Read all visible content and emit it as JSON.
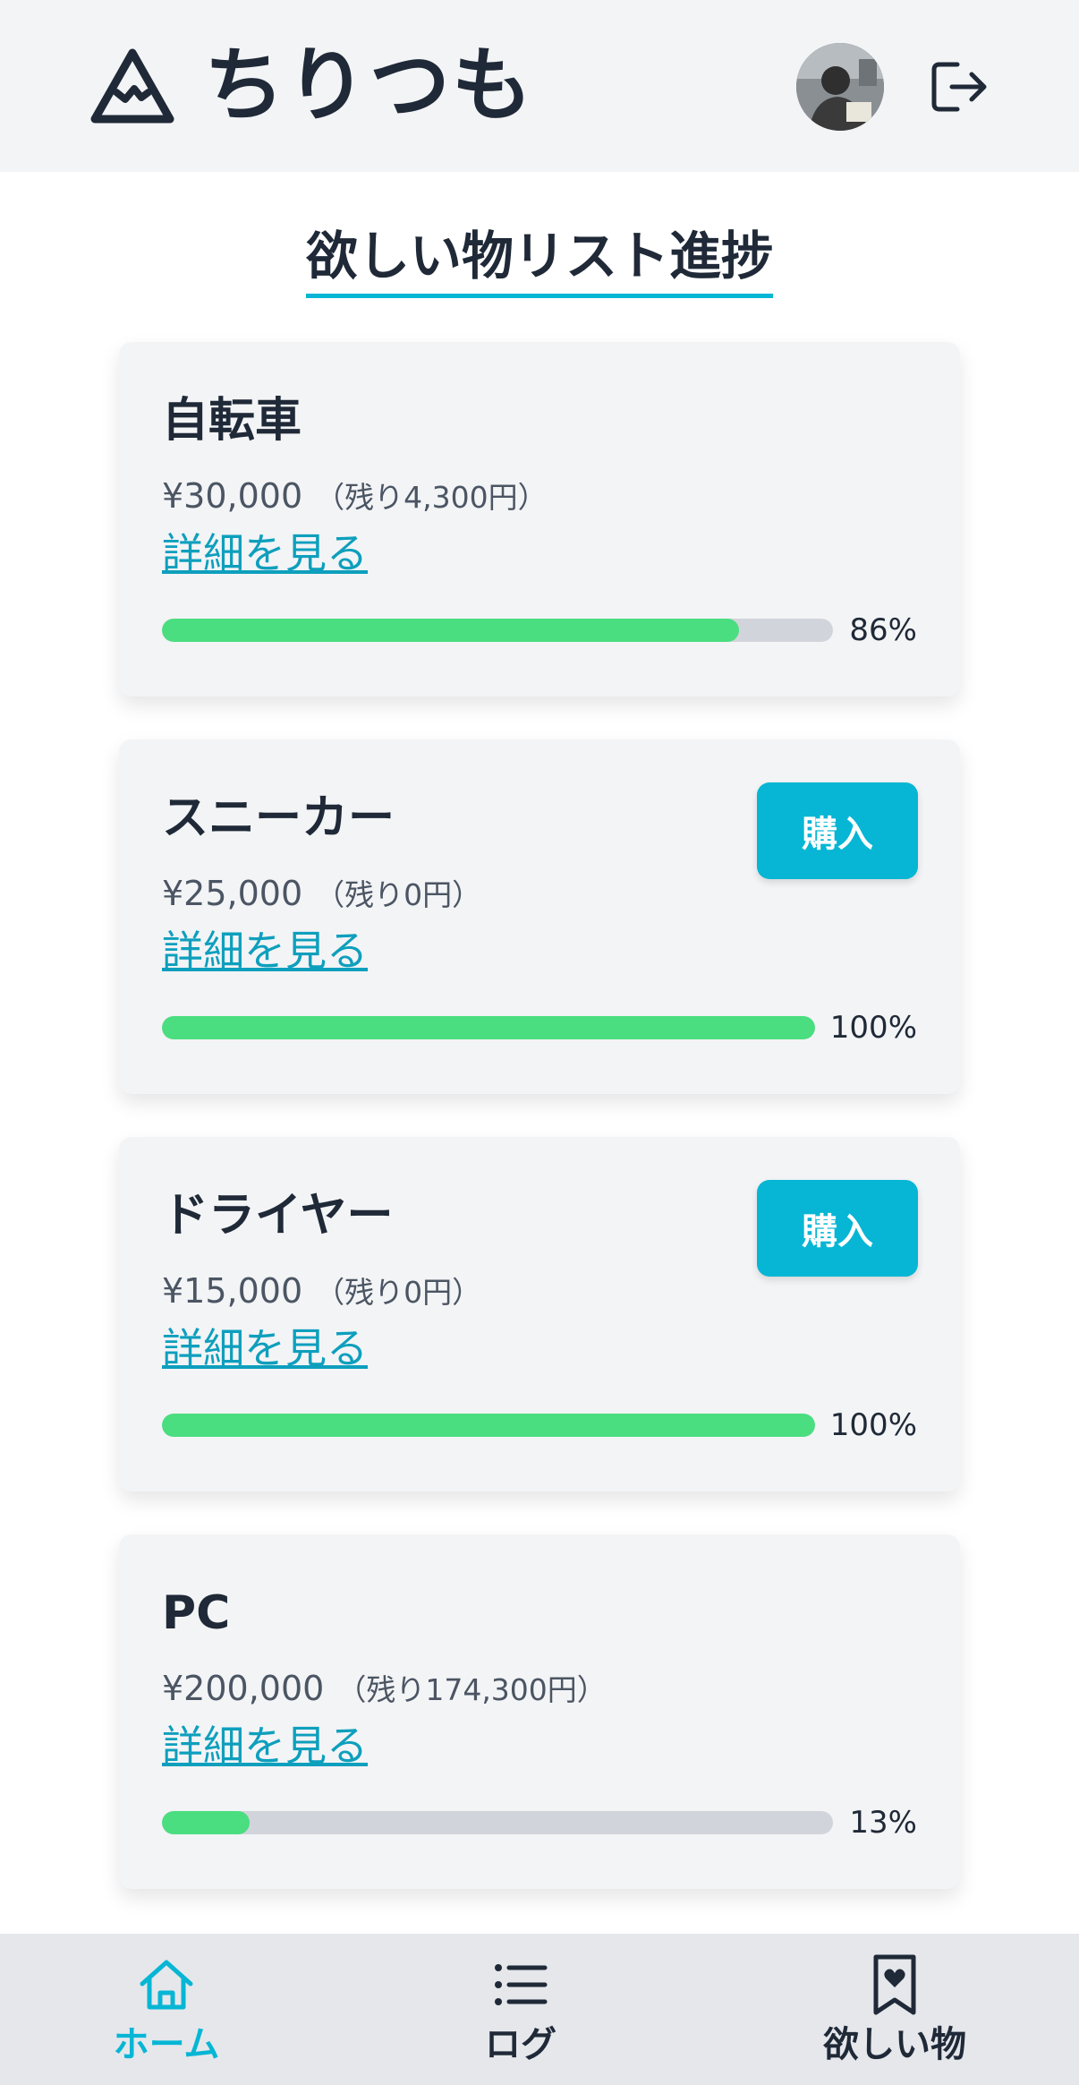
{
  "header": {
    "title": "ちりつも",
    "logo_icon": "mountain-icon",
    "avatar_icon": "user-avatar",
    "logout_icon": "logout-icon"
  },
  "section": {
    "title": "欲しい物リスト進捗"
  },
  "colors": {
    "accent": "#06b6d4",
    "progress": "#4ade80",
    "track": "#d1d5db",
    "link": "#0e9fbd",
    "card_bg": "#f3f4f6"
  },
  "items": [
    {
      "name": "自転車",
      "price": "¥30,000",
      "remaining": "（残り4,300円）",
      "detail_link": "詳細を見る",
      "progress_pct": 86,
      "progress_label": "86%",
      "buy_label": ""
    },
    {
      "name": "スニーカー",
      "price": "¥25,000",
      "remaining": "（残り0円）",
      "detail_link": "詳細を見る",
      "progress_pct": 100,
      "progress_label": "100%",
      "buy_label": "購入"
    },
    {
      "name": "ドライヤー",
      "price": "¥15,000",
      "remaining": "（残り0円）",
      "detail_link": "詳細を見る",
      "progress_pct": 100,
      "progress_label": "100%",
      "buy_label": "購入"
    },
    {
      "name": "PC",
      "price": "¥200,000",
      "remaining": "（残り174,300円）",
      "detail_link": "詳細を見る",
      "progress_pct": 13,
      "progress_label": "13%",
      "buy_label": ""
    }
  ],
  "nav": {
    "home": {
      "label": "ホーム",
      "icon": "home-icon",
      "active": true
    },
    "log": {
      "label": "ログ",
      "icon": "list-icon",
      "active": false
    },
    "wishlist": {
      "label": "欲しい物",
      "icon": "bookmark-heart-icon",
      "active": false
    }
  }
}
